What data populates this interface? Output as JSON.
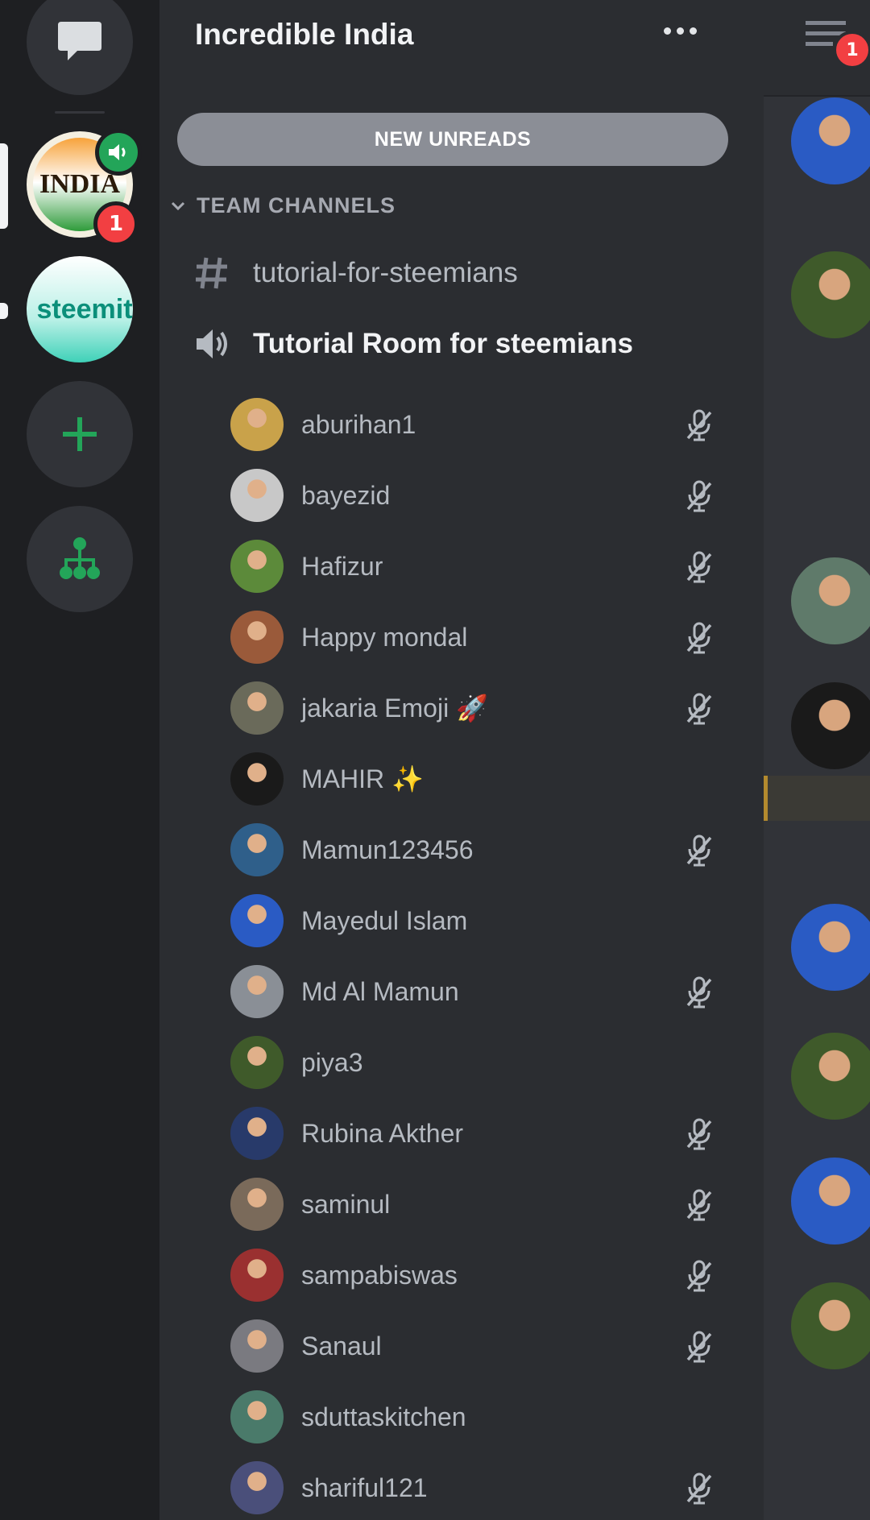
{
  "server": {
    "name": "Incredible India",
    "new_unreads_label": "NEW UNREADS",
    "category": "TEAM CHANNELS",
    "text_channel": "tutorial-for-steemians",
    "voice_channel": "Tutorial Room for steemians"
  },
  "rail": {
    "india_logo_text": "INDIA",
    "india_badge": "1",
    "steemit_logo_text": "steemit"
  },
  "members": [
    {
      "name": "aburihan1",
      "muted": true,
      "color": "#c9a24a"
    },
    {
      "name": "bayezid",
      "muted": true,
      "color": "#c8c8c8"
    },
    {
      "name": "Hafizur",
      "muted": true,
      "color": "#5c8a3a"
    },
    {
      "name": "Happy mondal",
      "muted": true,
      "color": "#9a5a3a"
    },
    {
      "name": "jakaria Emoji 🚀",
      "muted": true,
      "color": "#6a6a5a"
    },
    {
      "name": "MAHIR ✨",
      "muted": false,
      "color": "#1a1a1a"
    },
    {
      "name": "Mamun123456",
      "muted": true,
      "color": "#2f5f8a"
    },
    {
      "name": "Mayedul Islam",
      "muted": false,
      "color": "#2a5bc4"
    },
    {
      "name": "Md Al Mamun",
      "muted": true,
      "color": "#8a8f96"
    },
    {
      "name": "piya3",
      "muted": false,
      "color": "#3f5a2a"
    },
    {
      "name": "Rubina Akther",
      "muted": true,
      "color": "#283a6a"
    },
    {
      "name": "saminul",
      "muted": true,
      "color": "#7a6a5a"
    },
    {
      "name": "sampabiswas",
      "muted": true,
      "color": "#9a3030"
    },
    {
      "name": "Sanaul",
      "muted": true,
      "color": "#7a7a80"
    },
    {
      "name": "sduttaskitchen",
      "muted": false,
      "color": "#4a7a6a"
    },
    {
      "name": "shariful121",
      "muted": true,
      "color": "#4a4f7a"
    }
  ],
  "right_strip": {
    "notif_badge": "1",
    "avatar_colors": [
      "#2a5bc4",
      "#3f5a2a",
      "#5f7a6a",
      "#1a1a1a",
      "#2a5bc4",
      "#3f5a2a",
      "#2a5bc4",
      "#3f5a2a"
    ]
  },
  "colors": {
    "rail_bg": "#1e1f22",
    "panel_bg": "#2b2d31",
    "accent_green": "#23a559",
    "badge_red": "#f23f42"
  }
}
